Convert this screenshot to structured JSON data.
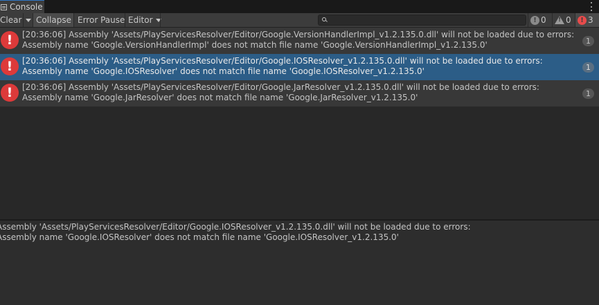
{
  "window": {
    "tab_title": "Console"
  },
  "toolbar": {
    "clear_label": "Clear",
    "collapse_label": "Collapse",
    "error_pause_label": "Error Pause",
    "editor_label": "Editor",
    "search_placeholder": "",
    "log_count": "0",
    "warning_count": "0",
    "error_count": "3"
  },
  "logs": [
    {
      "line1": "[20:36:06] Assembly 'Assets/PlayServicesResolver/Editor/Google.VersionHandlerImpl_v1.2.135.0.dll' will not be loaded due to errors:",
      "line2": "Assembly name 'Google.VersionHandlerImpl' does not match file name 'Google.VersionHandlerImpl_v1.2.135.0'",
      "count": "1",
      "icon": "error-icon",
      "selected": false
    },
    {
      "line1": "[20:36:06] Assembly 'Assets/PlayServicesResolver/Editor/Google.IOSResolver_v1.2.135.0.dll' will not be loaded due to errors:",
      "line2": "Assembly name 'Google.IOSResolver' does not match file name 'Google.IOSResolver_v1.2.135.0'",
      "count": "1",
      "icon": "error-icon",
      "selected": true
    },
    {
      "line1": "[20:36:06] Assembly 'Assets/PlayServicesResolver/Editor/Google.JarResolver_v1.2.135.0.dll' will not be loaded due to errors:",
      "line2": "Assembly name 'Google.JarResolver' does not match file name 'Google.JarResolver_v1.2.135.0'",
      "count": "1",
      "icon": "error-icon",
      "selected": false
    }
  ],
  "detail": {
    "line1": "Assembly 'Assets/PlayServicesResolver/Editor/Google.IOSResolver_v1.2.135.0.dll' will not be loaded due to errors:",
    "line2": "Assembly name 'Google.IOSResolver' does not match file name 'Google.IOSResolver_v1.2.135.0'"
  },
  "colors": {
    "selected_row": "#2c5d87",
    "error_red": "#dd3a3a",
    "tab_accent": "#2f78c7"
  }
}
